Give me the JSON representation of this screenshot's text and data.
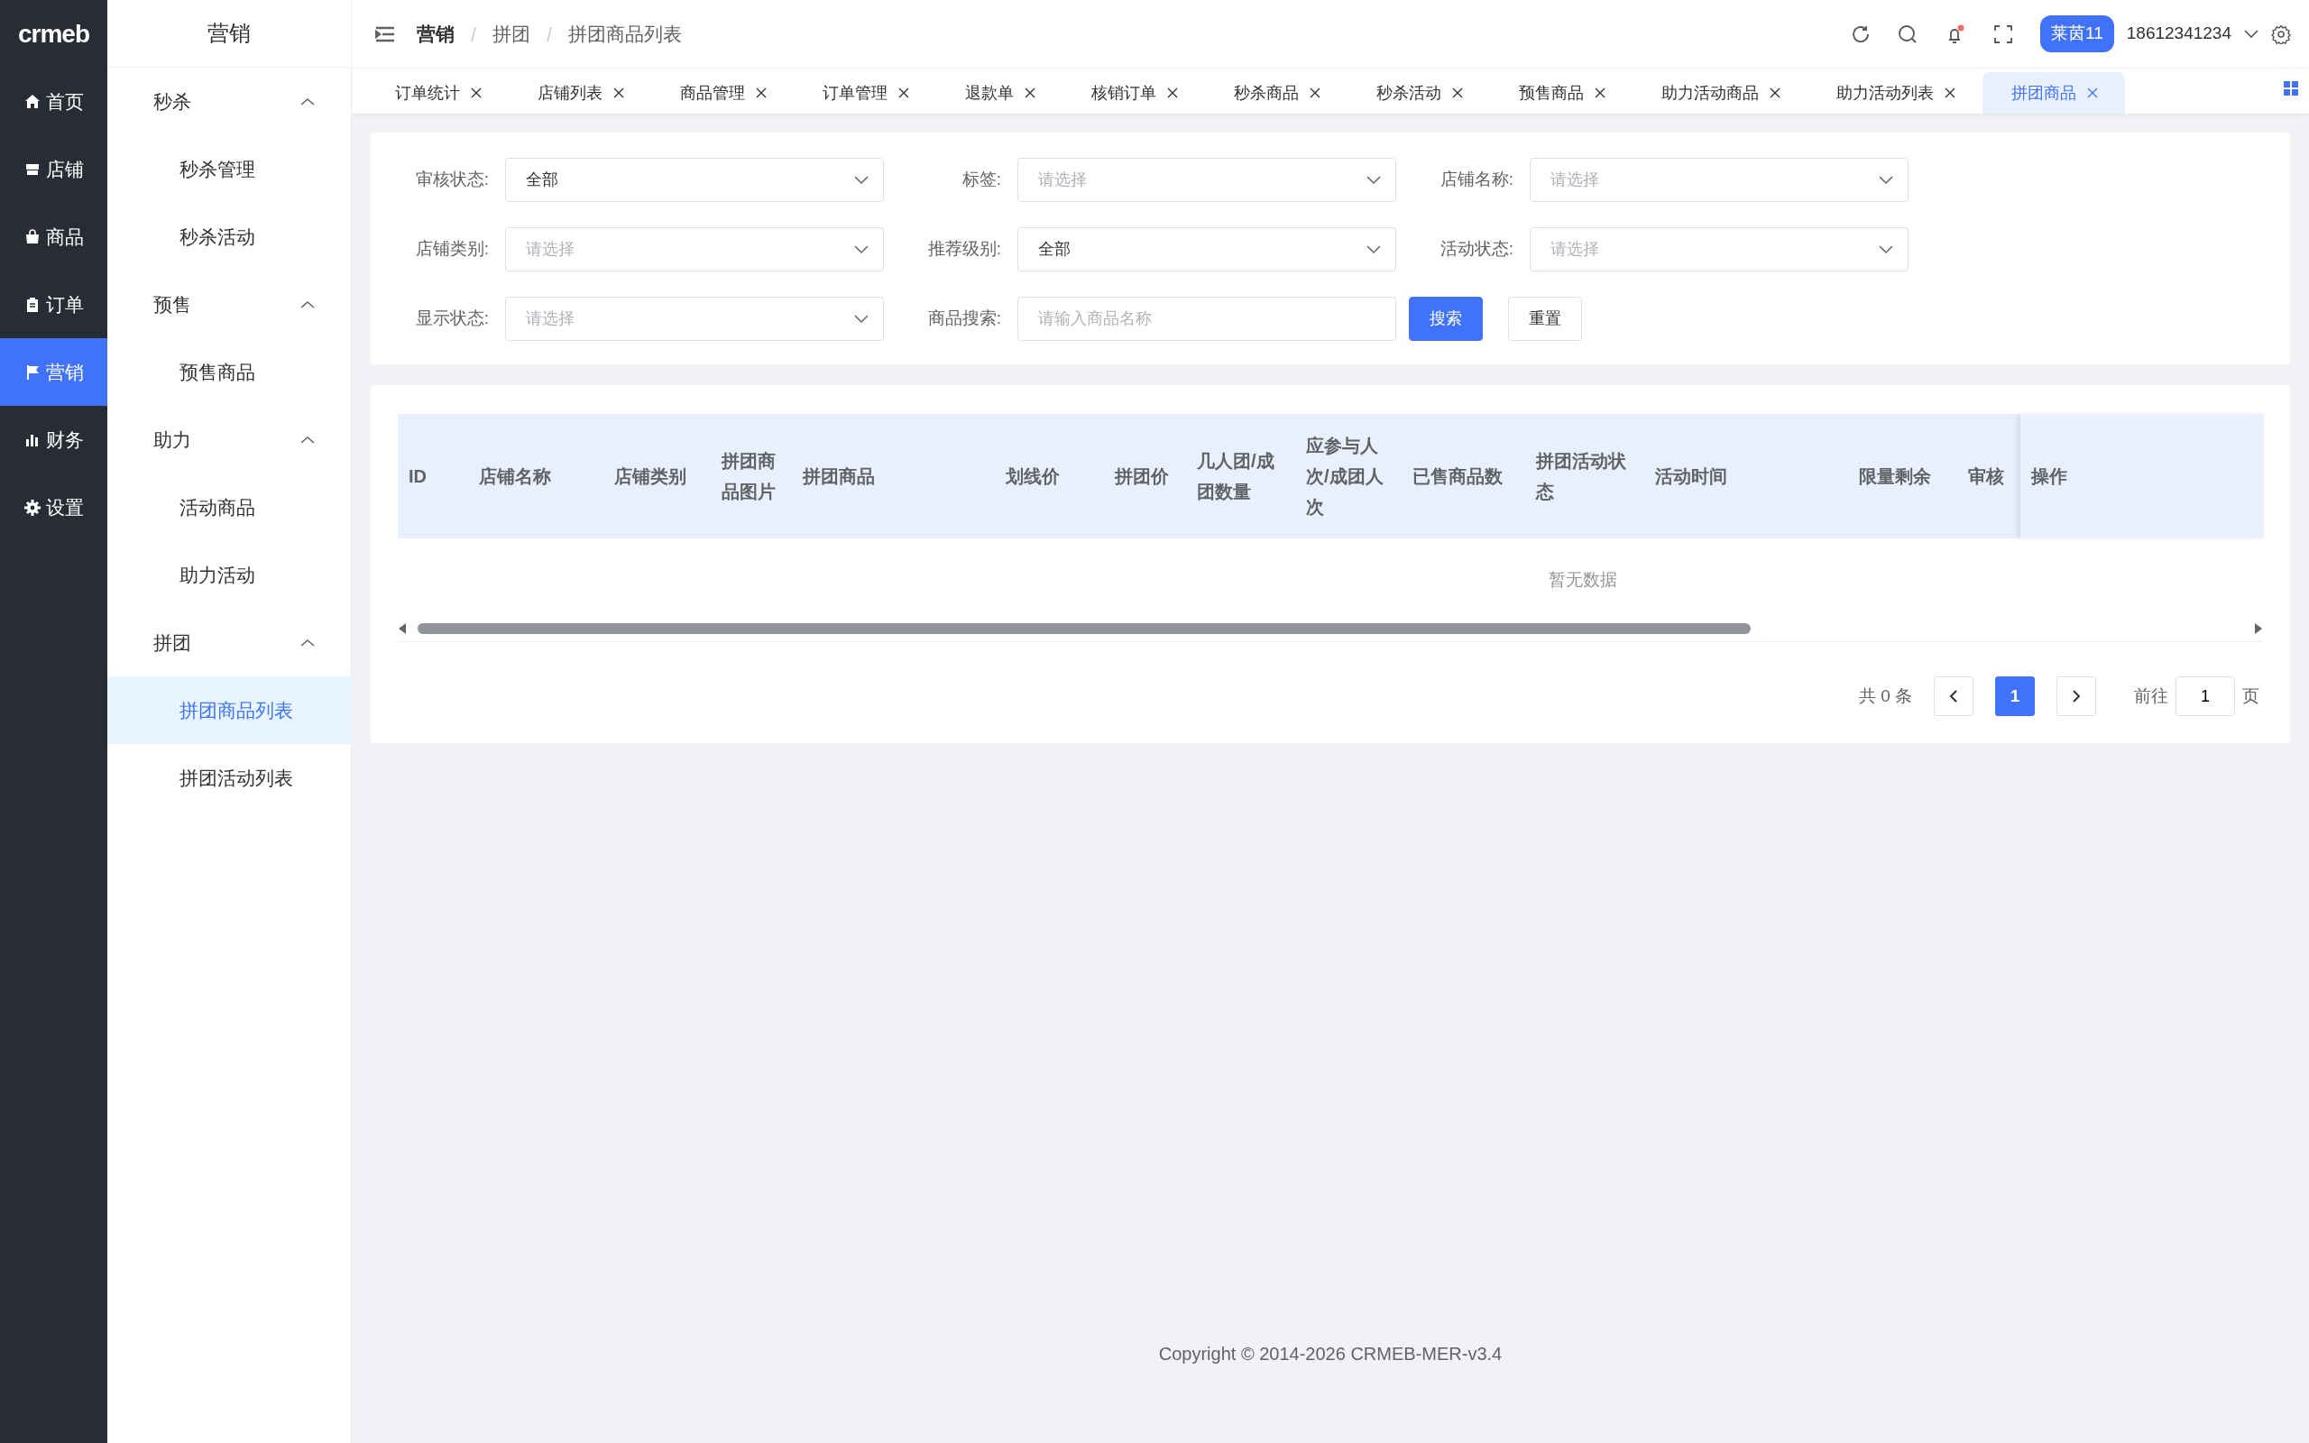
{
  "logo": "crmeb",
  "main_nav": [
    {
      "label": "首页",
      "selected": false
    },
    {
      "label": "店铺",
      "selected": false
    },
    {
      "label": "商品",
      "selected": false
    },
    {
      "label": "订单",
      "selected": false
    },
    {
      "label": "营销",
      "selected": true
    },
    {
      "label": "财务",
      "selected": false
    },
    {
      "label": "设置",
      "selected": false
    }
  ],
  "sub_nav": {
    "title": "营销",
    "groups": [
      {
        "label": "秒杀",
        "expanded": true,
        "items": [
          {
            "label": "秒杀管理",
            "selected": false
          },
          {
            "label": "秒杀活动",
            "selected": false
          }
        ]
      },
      {
        "label": "预售",
        "expanded": true,
        "items": [
          {
            "label": "预售商品",
            "selected": false
          }
        ]
      },
      {
        "label": "助力",
        "expanded": true,
        "items": [
          {
            "label": "活动商品",
            "selected": false
          },
          {
            "label": "助力活动",
            "selected": false
          }
        ]
      },
      {
        "label": "拼团",
        "expanded": true,
        "items": [
          {
            "label": "拼团商品列表",
            "selected": true
          },
          {
            "label": "拼团活动列表",
            "selected": false
          }
        ]
      }
    ]
  },
  "breadcrumb": [
    "营销",
    "拼团",
    "拼团商品列表"
  ],
  "header": {
    "store_badge": "莱茵11",
    "account": "18612341234"
  },
  "tabs": [
    {
      "label": "订单统计",
      "selected": false
    },
    {
      "label": "店铺列表",
      "selected": false
    },
    {
      "label": "商品管理",
      "selected": false
    },
    {
      "label": "订单管理",
      "selected": false
    },
    {
      "label": "退款单",
      "selected": false
    },
    {
      "label": "核销订单",
      "selected": false
    },
    {
      "label": "秒杀商品",
      "selected": false
    },
    {
      "label": "秒杀活动",
      "selected": false
    },
    {
      "label": "预售商品",
      "selected": false
    },
    {
      "label": "助力活动商品",
      "selected": false
    },
    {
      "label": "助力活动列表",
      "selected": false
    },
    {
      "label": "拼团商品",
      "selected": true
    }
  ],
  "filters": [
    {
      "kind": "select",
      "label": "审核状态:",
      "value": "全部"
    },
    {
      "kind": "select",
      "label": "标签:",
      "placeholder": "请选择"
    },
    {
      "kind": "select",
      "label": "店铺名称:",
      "placeholder": "请选择"
    },
    {
      "kind": "select",
      "label": "店铺类别:",
      "placeholder": "请选择"
    },
    {
      "kind": "select",
      "label": "推荐级别:",
      "value": "全部"
    },
    {
      "kind": "select",
      "label": "活动状态:",
      "placeholder": "请选择"
    },
    {
      "kind": "select",
      "label": "显示状态:",
      "placeholder": "请选择"
    },
    {
      "kind": "input",
      "label": "商品搜索:",
      "placeholder": "请输入商品名称"
    }
  ],
  "search_button": "搜索",
  "reset_button": "重置",
  "table": {
    "columns": [
      "ID",
      "店铺名称",
      "店铺类别",
      "拼团商品图片",
      "拼团商品",
      "划线价",
      "拼团价",
      "几人团/成团数量",
      "应参与人次/成团人次",
      "已售商品数",
      "拼团活动状态",
      "活动时间",
      "限量剩余",
      "审核",
      "操作"
    ],
    "empty_text": "暂无数据"
  },
  "pagination": {
    "total": "共 0 条",
    "pages": [
      {
        "label": "1",
        "selected": true
      }
    ],
    "goto_label": "前往",
    "goto_value": "1",
    "page_suffix": "页"
  },
  "footer": "Copyright © 2014-2026 CRMEB-MER-v3.4"
}
